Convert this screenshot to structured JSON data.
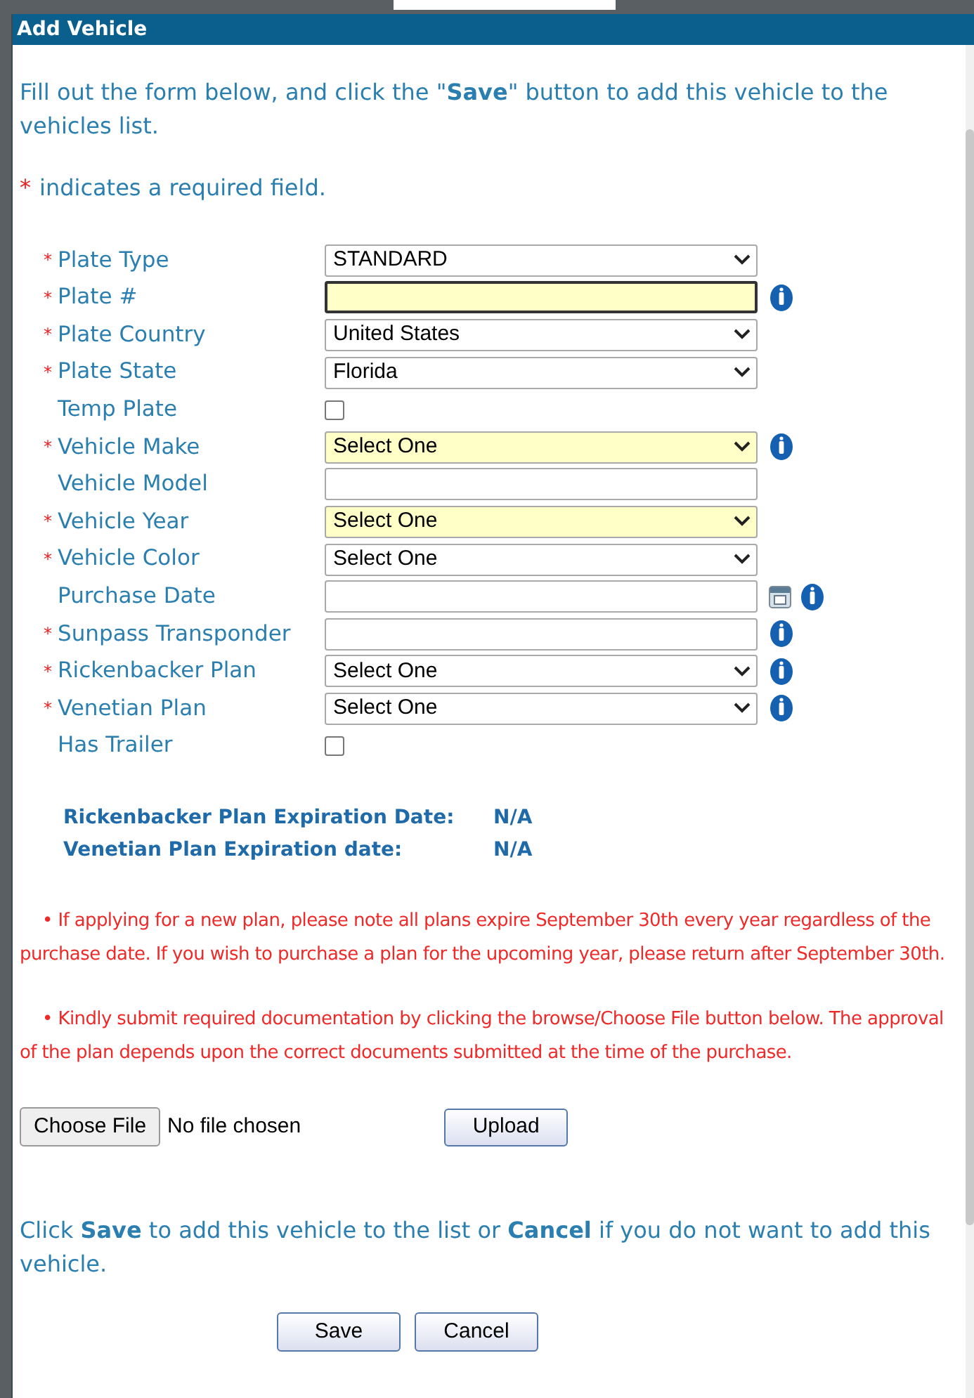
{
  "window": {
    "title": "Add Vehicle"
  },
  "intro": "Fill out the form below, and click the \"**Save**\" button to add this vehicle to the vehicles list.",
  "required_note": {
    "mark": "*",
    "text": "indicates a required field."
  },
  "fields": [
    {
      "label": "Plate Type",
      "required": true,
      "kind": "select",
      "value": "STANDARD",
      "highlighted": false,
      "focused": false,
      "info": false,
      "calendar": false
    },
    {
      "label": "Plate #",
      "required": true,
      "kind": "text",
      "highlighted": true,
      "focused": true,
      "info": true,
      "calendar": false
    },
    {
      "label": "Plate Country",
      "required": true,
      "kind": "select",
      "value": "United States",
      "highlighted": false,
      "focused": false,
      "info": false,
      "calendar": false
    },
    {
      "label": "Plate State",
      "required": true,
      "kind": "select",
      "value": "Florida",
      "highlighted": false,
      "focused": false,
      "info": false,
      "calendar": false
    },
    {
      "label": "Temp Plate",
      "required": false,
      "kind": "checkbox",
      "checked": false,
      "info": false,
      "calendar": false
    },
    {
      "label": "Vehicle Make",
      "required": true,
      "kind": "select",
      "value": "Select One",
      "highlighted": true,
      "focused": false,
      "info": true,
      "calendar": false
    },
    {
      "label": "Vehicle Model",
      "required": false,
      "kind": "text",
      "highlighted": false,
      "focused": false,
      "info": false,
      "calendar": false
    },
    {
      "label": "Vehicle Year",
      "required": true,
      "kind": "select",
      "value": "Select One",
      "highlighted": true,
      "focused": false,
      "info": false,
      "calendar": false
    },
    {
      "label": "Vehicle Color",
      "required": true,
      "kind": "select",
      "value": "Select One",
      "highlighted": false,
      "focused": false,
      "info": false,
      "calendar": false
    },
    {
      "label": "Purchase Date",
      "required": false,
      "kind": "text",
      "highlighted": false,
      "focused": false,
      "info": true,
      "calendar": true
    },
    {
      "label": "Sunpass Transponder",
      "required": true,
      "kind": "text",
      "highlighted": false,
      "focused": false,
      "info": true,
      "calendar": false
    },
    {
      "label": "Rickenbacker Plan",
      "required": true,
      "kind": "select",
      "value": "Select One",
      "highlighted": false,
      "focused": false,
      "info": true,
      "calendar": false
    },
    {
      "label": "Venetian Plan",
      "required": true,
      "kind": "select",
      "value": "Select One",
      "highlighted": false,
      "focused": false,
      "info": true,
      "calendar": false
    },
    {
      "label": "Has Trailer",
      "required": false,
      "kind": "checkbox",
      "checked": false,
      "info": false,
      "calendar": false
    }
  ],
  "expirations": [
    {
      "label": "Rickenbacker Plan Expiration Date:",
      "value": "N/A"
    },
    {
      "label": "Venetian Plan Expiration date:",
      "value": "N/A"
    }
  ],
  "notes": [
    {
      "bullet": "•",
      "text": "If applying for a new plan, please note all plans expire September 30th every year regardless of the purchase date. If you wish to purchase a plan for the upcoming year, please return after September 30th."
    },
    {
      "bullet": "•",
      "text": "Kindly submit required documentation by clicking the browse/Choose File button below. The approval of the plan depends upon the correct documents submitted at the time of the purchase."
    }
  ],
  "file_upload": {
    "button": "Choose File",
    "status": "No file chosen",
    "upload": "Upload"
  },
  "footer_text": "Click **Save** to add this vehicle to the list or **Cancel** if you do not want to add this vehicle.",
  "buttons": [
    "Save",
    "Cancel"
  ]
}
